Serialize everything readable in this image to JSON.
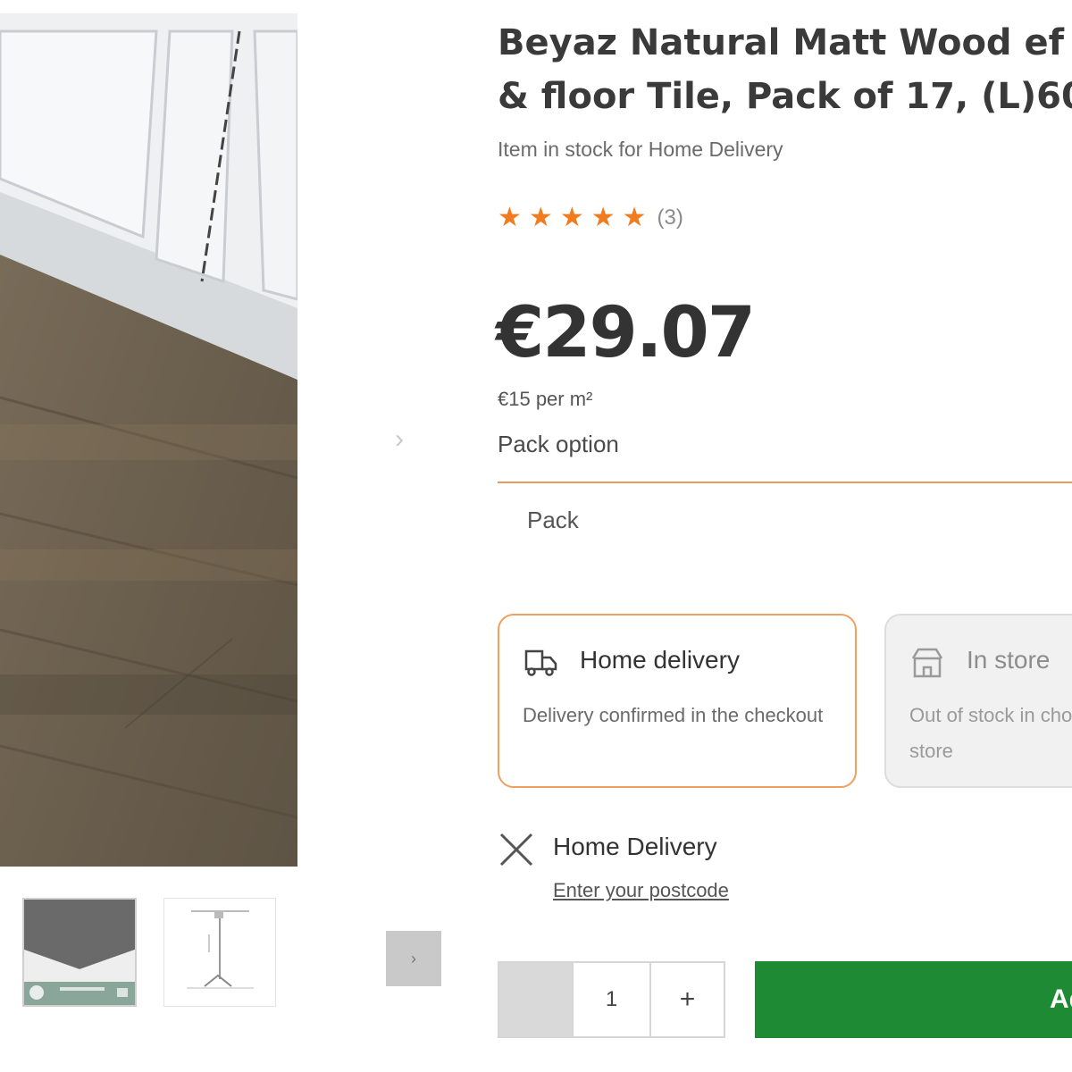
{
  "product": {
    "title_line1": "Beyaz Natural Matt Wood ef",
    "title_line2": "& floor Tile, Pack of 17, (L)60",
    "stock_text": "Item in stock for Home Delivery",
    "rating": {
      "stars": 5,
      "count_text": "(3)"
    },
    "price": "€29.07",
    "unit_price": "€15 per m²",
    "pack_option_label": "Pack option",
    "pack_option_value": "Pack"
  },
  "fulfilment": {
    "home_delivery": {
      "title": "Home delivery",
      "text": "Delivery confirmed in the checkout"
    },
    "in_store": {
      "title": "In store",
      "text": "Out of stock in chosen store"
    }
  },
  "delivery_status": {
    "title": "Home Delivery",
    "link": "Enter your postcode"
  },
  "quantity": {
    "minus": "",
    "value": "1",
    "plus": "+"
  },
  "add_button_label": "Add",
  "gallery": {
    "next_glyph": "›",
    "thumbs_next_glyph": "›"
  },
  "colors": {
    "accent": "#f07c1f",
    "cta_green": "#1f8a34"
  }
}
